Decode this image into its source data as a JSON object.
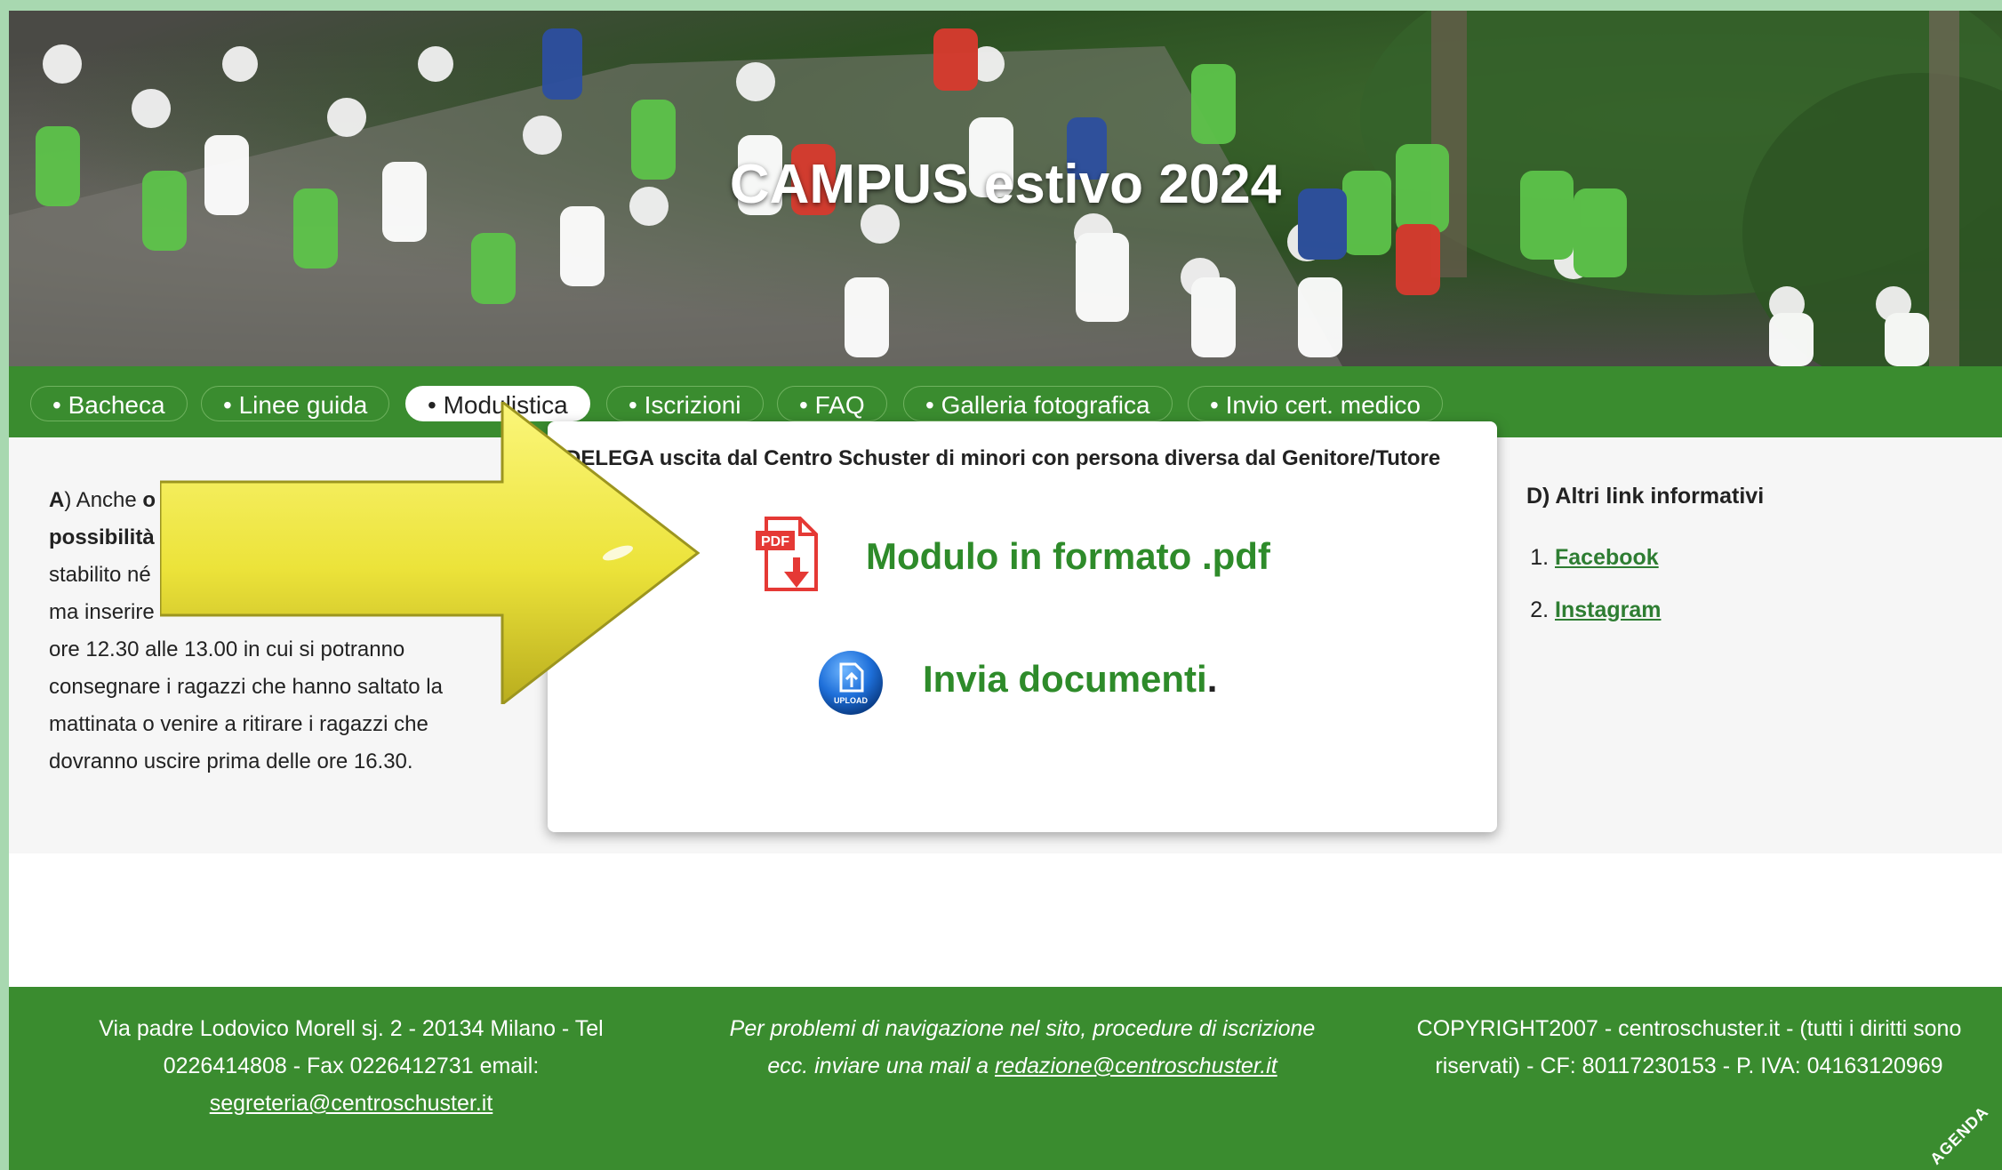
{
  "hero": {
    "title": "CAMPUS estivo 2024"
  },
  "nav": {
    "tabs": [
      {
        "label": "• Bacheca"
      },
      {
        "label": "• Linee guida"
      },
      {
        "label": "• Modulistica",
        "active": true
      },
      {
        "label": "• Iscrizioni"
      },
      {
        "label": "• FAQ"
      },
      {
        "label": "• Galleria fotografica"
      },
      {
        "label": "• Invio cert. medico"
      }
    ]
  },
  "left": {
    "lead_letter": "A",
    "lead_rest": ") Anche ",
    "bold_fragment": "o",
    "bold_line2": "possibilità",
    "line3": "stabilito né",
    "line4": "ma inserire",
    "line5": "ore 12.30 alle 13.00 in cui si potranno",
    "line6": "consegnare i ragazzi che hanno saltato la",
    "line7": "mattinata o venire a ritirare i ragazzi che",
    "line8": "dovranno uscire prima delle ore 16.30."
  },
  "popup": {
    "title": "DELEGA uscita dal Centro Schuster di minori con persona diversa dal Genitore/Tutore",
    "pdf_badge": "PDF",
    "pdf_link": "Modulo in formato .pdf",
    "upload_badge": "UPLOAD",
    "upload_link": "Invia documenti",
    "upload_dot": "."
  },
  "right": {
    "heading": "D) Altri link informativi",
    "links": [
      {
        "label": "Facebook"
      },
      {
        "label": "Instagram"
      }
    ]
  },
  "footer": {
    "left_line1": "Via padre Lodovico Morell sj. 2 - 20134 Milano - Tel",
    "left_line2": "0226414808 - Fax 0226412731 email:",
    "left_email": "segreteria@centroschuster.it",
    "mid_line1": "Per problemi di navigazione nel sito, procedure di iscrizione",
    "mid_line2_prefix": "ecc. inviare una mail a ",
    "mid_email": "redazione@centroschuster.it",
    "right_line1": "COPYRIGHT2007 - centroschuster.it - (tutti i diritti sono",
    "right_line2": "riservati) - CF: 80117230153 - P. IVA: 04163120969",
    "agenda": "AGENDA"
  },
  "colors": {
    "nav_green": "#3a8c2f",
    "link_green": "#2e8b2a",
    "arrow_yellow": "#f2ea3a",
    "pdf_red": "#e53935",
    "upload_blue": "#1e6fd9"
  },
  "icons": [
    "pdf-icon",
    "upload-icon",
    "arrow-icon"
  ]
}
